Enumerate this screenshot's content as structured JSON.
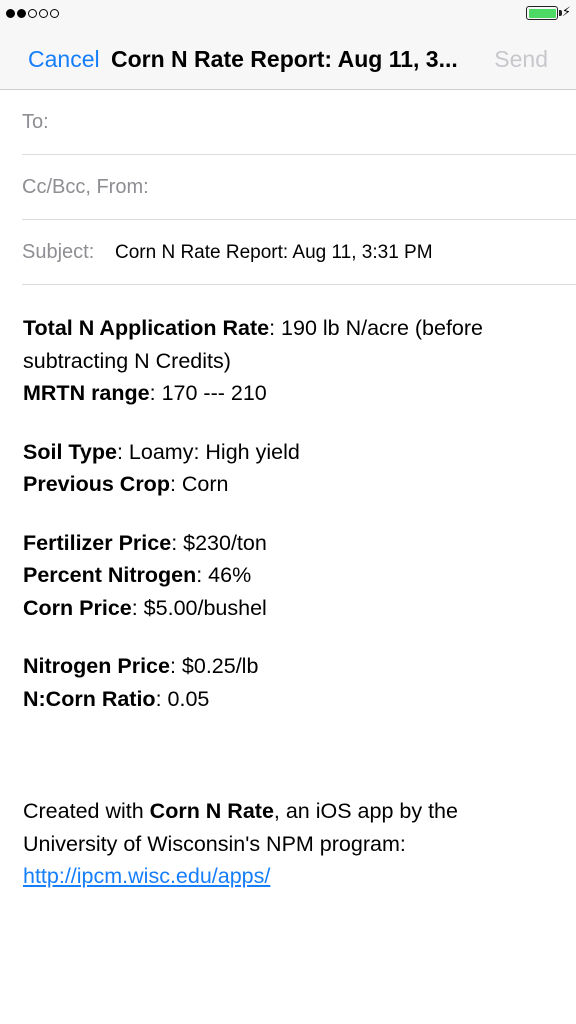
{
  "status_bar": {
    "signal_icon": "signal-dots-icon",
    "battery_icon": "battery-icon",
    "charging_icon": "charging-bolt-icon",
    "charging_glyph": "⚡",
    "battery_color": "#4cd964"
  },
  "nav": {
    "cancel_label": "Cancel",
    "title": "Corn N Rate Report: Aug 11, 3...",
    "send_label": "Send",
    "accent_color": "#157efb"
  },
  "fields": {
    "to_label": "To:",
    "cc_label": "Cc/Bcc, From:",
    "subject_label": "Subject:",
    "subject_value": "Corn N Rate Report: Aug 11, 3:31 PM"
  },
  "report": {
    "total_n_label": "Total N Application Rate",
    "total_n_value": ": 190 lb N/acre (before subtracting N Credits)",
    "mrtn_label": "MRTN range",
    "mrtn_value": ": 170 --- 210",
    "soil_label": "Soil Type",
    "soil_value": ": Loamy: High yield",
    "crop_label": "Previous Crop",
    "crop_value": ": Corn",
    "fert_price_label": "Fertilizer Price",
    "fert_price_value": ": $230/ton",
    "percent_n_label": "Percent Nitrogen",
    "percent_n_value": ": 46%",
    "corn_price_label": "Corn Price",
    "corn_price_value": ": $5.00/bushel",
    "n_price_label": "Nitrogen Price",
    "n_price_value": ": $0.25/lb",
    "ratio_label": "N:Corn Ratio",
    "ratio_value": ": 0.05"
  },
  "footer": {
    "created_prefix": "Created with ",
    "app_name": "Corn N Rate",
    "created_suffix": ", an iOS app by the University of Wisconsin's NPM program:",
    "link_text": "http://ipcm.wisc.edu/apps/"
  }
}
